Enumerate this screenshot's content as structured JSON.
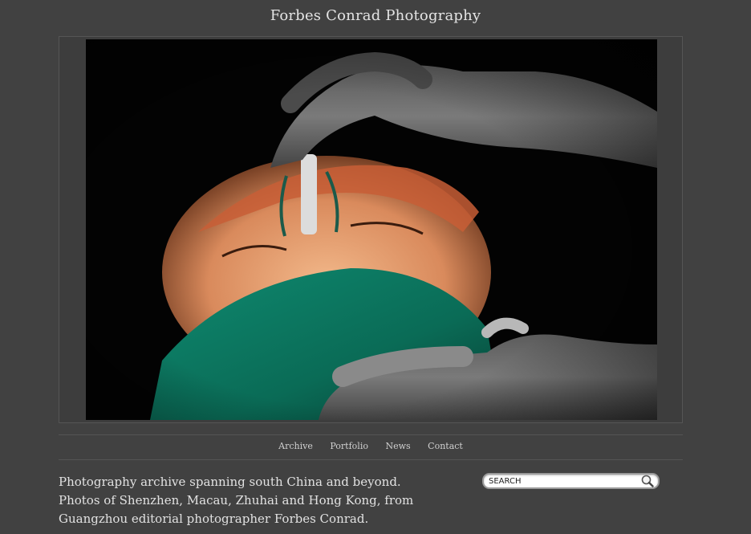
{
  "header": {
    "site_title": "Forbes Conrad Photography"
  },
  "hero": {
    "image_subject": "surgery-photo"
  },
  "nav": {
    "items": [
      {
        "label": "Archive"
      },
      {
        "label": "Portfolio"
      },
      {
        "label": "News"
      },
      {
        "label": "Contact"
      }
    ]
  },
  "intro": {
    "text": "Photography archive spanning south China and beyond. Photos of Shenzhen, Macau, Zhuhai and Hong Kong, from Guangzhou editorial photographer Forbes Conrad."
  },
  "search": {
    "placeholder": "SEARCH",
    "value": "",
    "icon": "magnifier-icon"
  },
  "colors": {
    "background": "#414141",
    "text": "#e2e2e2",
    "rule": "#555555"
  }
}
